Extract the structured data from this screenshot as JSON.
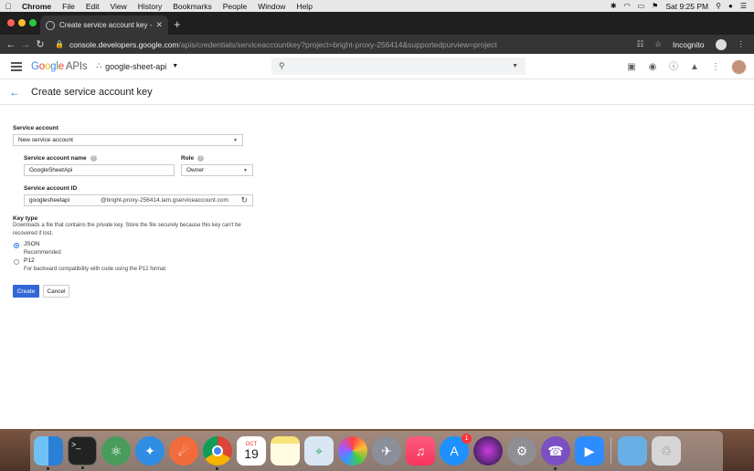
{
  "menubar": {
    "items": [
      "Chrome",
      "File",
      "Edit",
      "View",
      "History",
      "Bookmarks",
      "People",
      "Window",
      "Help"
    ],
    "clock": "Sat 9:25 PM"
  },
  "browser": {
    "tab_title": "Create service account key - ",
    "url_host": "console.developers.google.com",
    "url_path": "/apis/credentials/serviceaccountkey?project=bright-proxy-256414&supportedpurview=project",
    "incognito_label": "Incognito"
  },
  "header": {
    "logo_google": "Google",
    "logo_apis": "APIs",
    "project_name": "google-sheet-api"
  },
  "page": {
    "title": "Create service account key"
  },
  "form": {
    "service_account_label": "Service account",
    "service_account_value": "New service account",
    "account_name_label": "Service account name",
    "account_name_value": "GoogleSheetApi",
    "role_label": "Role",
    "role_value": "Owner",
    "account_id_label": "Service account ID",
    "account_id_value": "googlesheetapi",
    "account_id_suffix": "@bright-proxy-256414.iam.gserviceaccount.com",
    "key_type_label": "Key type",
    "key_type_desc": "Downloads a file that contains the private key. Store the file securely because this key can't be recovered if lost.",
    "options": [
      {
        "label": "JSON",
        "desc": "Recommended",
        "selected": true
      },
      {
        "label": "P12",
        "desc": "For backward compatibility with code using the P12 format",
        "selected": false
      }
    ],
    "create_label": "Create",
    "cancel_label": "Cancel"
  },
  "dock": {
    "calendar_month": "OCT",
    "calendar_day": "19",
    "appstore_badge": "1",
    "apps": [
      "finder",
      "terminal",
      "atom",
      "safari",
      "postman",
      "chrome",
      "calendar",
      "notes",
      "preview",
      "photos",
      "launchpad",
      "music",
      "app-store",
      "siri",
      "system-preferences",
      "viber",
      "zoom",
      "downloads",
      "trash"
    ]
  },
  "colors": {
    "accent": "#1a73e8",
    "primary_button": "#3367d6"
  }
}
